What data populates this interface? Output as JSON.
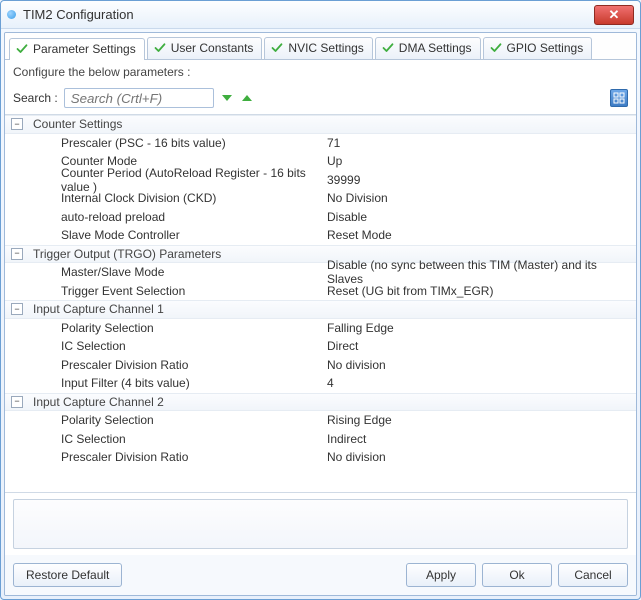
{
  "window": {
    "title": "TIM2 Configuration"
  },
  "tabs": [
    {
      "label": "Parameter Settings"
    },
    {
      "label": "User Constants"
    },
    {
      "label": "NVIC Settings"
    },
    {
      "label": "DMA Settings"
    },
    {
      "label": "GPIO Settings"
    }
  ],
  "subheader": "Configure the below parameters :",
  "search": {
    "label": "Search :",
    "placeholder": "Search (Crtl+F)"
  },
  "sections": [
    {
      "title": "Counter Settings",
      "rows": [
        {
          "label": "Prescaler (PSC - 16 bits value)",
          "value": "71"
        },
        {
          "label": "Counter Mode",
          "value": "Up"
        },
        {
          "label": "Counter Period (AutoReload Register - 16 bits value )",
          "value": "39999"
        },
        {
          "label": "Internal Clock Division (CKD)",
          "value": "No Division"
        },
        {
          "label": "auto-reload preload",
          "value": "Disable"
        },
        {
          "label": "Slave Mode Controller",
          "value": "Reset Mode"
        }
      ]
    },
    {
      "title": "Trigger Output (TRGO) Parameters",
      "rows": [
        {
          "label": "Master/Slave Mode",
          "value": "Disable (no sync between this TIM (Master) and its Slaves"
        },
        {
          "label": "Trigger Event Selection",
          "value": "Reset (UG bit from TIMx_EGR)"
        }
      ]
    },
    {
      "title": "Input Capture Channel 1",
      "rows": [
        {
          "label": "Polarity Selection",
          "value": "Falling Edge"
        },
        {
          "label": "IC Selection",
          "value": "Direct"
        },
        {
          "label": "Prescaler Division Ratio",
          "value": "No division"
        },
        {
          "label": "Input Filter (4 bits value)",
          "value": "4"
        }
      ]
    },
    {
      "title": "Input Capture Channel 2",
      "rows": [
        {
          "label": "Polarity Selection",
          "value": "Rising Edge"
        },
        {
          "label": "IC Selection",
          "value": "Indirect"
        },
        {
          "label": "Prescaler Division Ratio",
          "value": "No division"
        }
      ]
    }
  ],
  "footer": {
    "restore": "Restore Default",
    "apply": "Apply",
    "ok": "Ok",
    "cancel": "Cancel"
  },
  "colors": {
    "check": "#4fb54f",
    "arrow": "#3fae3f",
    "grid": "#ffffff"
  }
}
